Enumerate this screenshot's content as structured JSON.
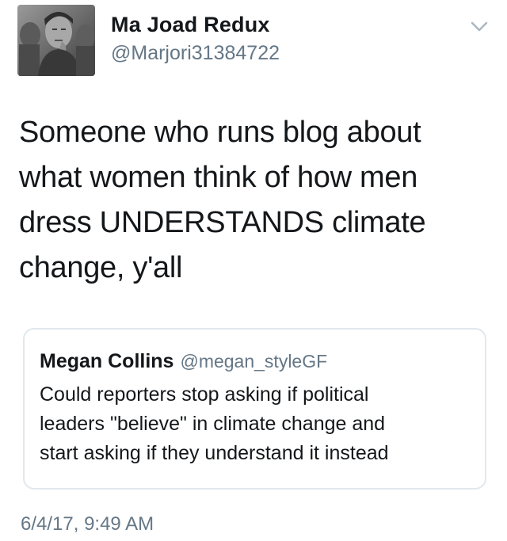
{
  "author": {
    "display_name": "Ma Joad Redux",
    "handle": "@Marjori31384722",
    "avatar_icon": "profile-photo"
  },
  "menu_icon": "chevron-down-icon",
  "tweet": {
    "lines": [
      "Someone who runs blog about",
      "what women think of how men",
      "dress UNDERSTANDS climate",
      "change, y'all"
    ]
  },
  "quoted_tweet": {
    "display_name": "Megan Collins",
    "handle": "@megan_styleGF",
    "lines": [
      "Could reporters stop asking if political",
      "leaders \"believe\" in climate change and",
      "start asking if they understand it instead"
    ]
  },
  "timestamp": "6/4/17, 9:49 AM",
  "colors": {
    "text": "#14171a",
    "secondary": "#657786",
    "border": "#e1e8ed"
  }
}
